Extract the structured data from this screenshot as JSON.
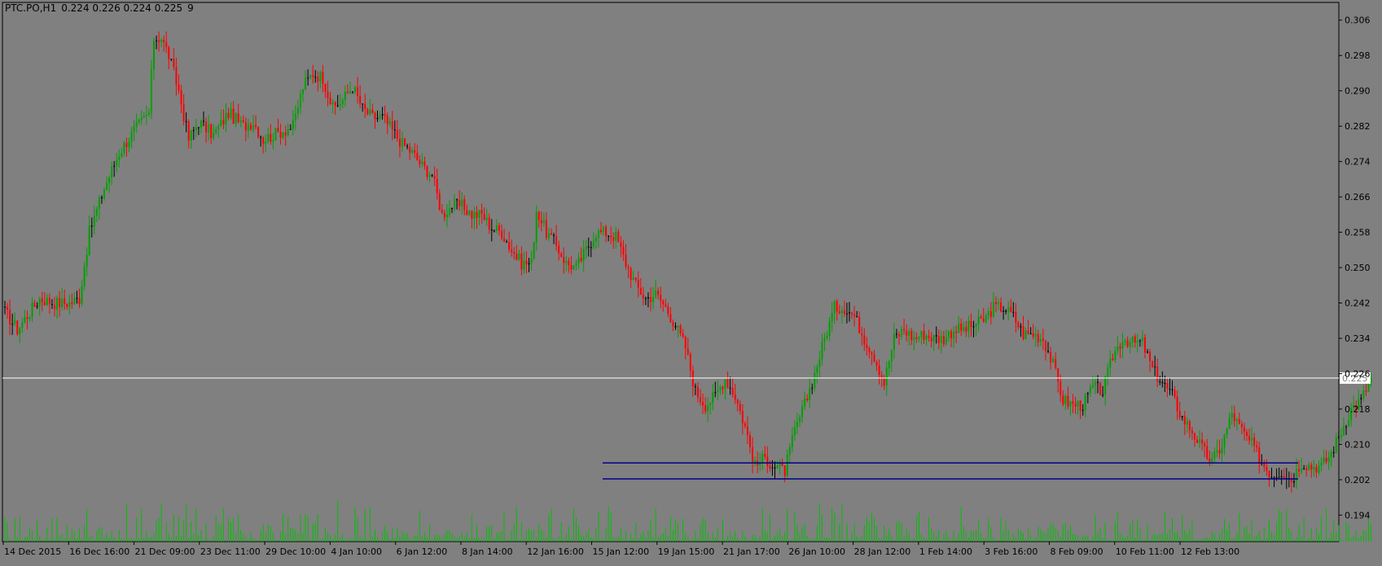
{
  "header": {
    "symbol": "PTC.PO,H1",
    "ohlc": "0.224 0.226 0.224 0.225",
    "spread": "9"
  },
  "current_price_label": "0.225",
  "colors": {
    "background": "#808080",
    "bull": "#00a000",
    "bear": "#ff0000",
    "doji": "#000000",
    "volume": "#00c000",
    "support_lines": "#00008b",
    "bid_line": "#ffffff",
    "axis": "#000000"
  },
  "chart_data": {
    "type": "candlestick",
    "title": "",
    "ylim": [
      0.188,
      0.31
    ],
    "y_ticks": [
      "0.306",
      "0.298",
      "0.290",
      "0.282",
      "0.274",
      "0.266",
      "0.258",
      "0.250",
      "0.242",
      "0.234",
      "0.226",
      "0.218",
      "0.210",
      "0.202",
      "0.194"
    ],
    "x_ticks": [
      "14 Dec 2015",
      "16 Dec 16:00",
      "21 Dec 09:00",
      "23 Dec 11:00",
      "29 Dec 10:00",
      "4 Jan 10:00",
      "6 Jan 12:00",
      "8 Jan 14:00",
      "12 Jan 16:00",
      "15 Jan 12:00",
      "19 Jan 15:00",
      "21 Jan 17:00",
      "26 Jan 10:00",
      "28 Jan 12:00",
      "1 Feb 14:00",
      "3 Feb 16:00",
      "8 Feb 09:00",
      "10 Feb 11:00",
      "12 Feb 13:00"
    ],
    "price_path": [
      [
        0,
        0.24
      ],
      [
        5,
        0.236
      ],
      [
        10,
        0.24
      ],
      [
        14,
        0.243
      ],
      [
        20,
        0.242
      ],
      [
        26,
        0.242
      ],
      [
        30,
        0.243
      ],
      [
        34,
        0.258
      ],
      [
        40,
        0.268
      ],
      [
        46,
        0.276
      ],
      [
        52,
        0.281
      ],
      [
        58,
        0.285
      ],
      [
        60,
        0.302
      ],
      [
        63,
        0.302
      ],
      [
        66,
        0.298
      ],
      [
        70,
        0.29
      ],
      [
        74,
        0.279
      ],
      [
        78,
        0.283
      ],
      [
        84,
        0.28
      ],
      [
        90,
        0.285
      ],
      [
        96,
        0.282
      ],
      [
        100,
        0.283
      ],
      [
        104,
        0.279
      ],
      [
        108,
        0.28
      ],
      [
        112,
        0.281
      ],
      [
        116,
        0.282
      ],
      [
        120,
        0.291
      ],
      [
        124,
        0.294
      ],
      [
        128,
        0.293
      ],
      [
        132,
        0.286
      ],
      [
        136,
        0.288
      ],
      [
        140,
        0.291
      ],
      [
        144,
        0.286
      ],
      [
        148,
        0.284
      ],
      [
        152,
        0.284
      ],
      [
        156,
        0.281
      ],
      [
        160,
        0.278
      ],
      [
        164,
        0.276
      ],
      [
        168,
        0.273
      ],
      [
        172,
        0.271
      ],
      [
        176,
        0.262
      ],
      [
        180,
        0.264
      ],
      [
        184,
        0.264
      ],
      [
        188,
        0.262
      ],
      [
        192,
        0.262
      ],
      [
        196,
        0.259
      ],
      [
        200,
        0.258
      ],
      [
        204,
        0.254
      ],
      [
        208,
        0.251
      ],
      [
        212,
        0.251
      ],
      [
        214,
        0.263
      ],
      [
        218,
        0.258
      ],
      [
        222,
        0.255
      ],
      [
        226,
        0.251
      ],
      [
        230,
        0.25
      ],
      [
        234,
        0.254
      ],
      [
        238,
        0.258
      ],
      [
        242,
        0.258
      ],
      [
        246,
        0.257
      ],
      [
        250,
        0.251
      ],
      [
        254,
        0.246
      ],
      [
        258,
        0.243
      ],
      [
        262,
        0.244
      ],
      [
        266,
        0.241
      ],
      [
        270,
        0.237
      ],
      [
        274,
        0.232
      ],
      [
        278,
        0.222
      ],
      [
        282,
        0.219
      ],
      [
        286,
        0.221
      ],
      [
        290,
        0.225
      ],
      [
        294,
        0.221
      ],
      [
        298,
        0.214
      ],
      [
        302,
        0.205
      ],
      [
        306,
        0.207
      ],
      [
        310,
        0.205
      ],
      [
        314,
        0.204
      ],
      [
        318,
        0.213
      ],
      [
        322,
        0.219
      ],
      [
        326,
        0.226
      ],
      [
        330,
        0.234
      ],
      [
        334,
        0.241
      ],
      [
        338,
        0.241
      ],
      [
        342,
        0.239
      ],
      [
        346,
        0.234
      ],
      [
        350,
        0.23
      ],
      [
        354,
        0.224
      ],
      [
        358,
        0.234
      ],
      [
        362,
        0.236
      ],
      [
        366,
        0.234
      ],
      [
        370,
        0.235
      ],
      [
        374,
        0.234
      ],
      [
        378,
        0.234
      ],
      [
        382,
        0.236
      ],
      [
        386,
        0.236
      ],
      [
        390,
        0.237
      ],
      [
        394,
        0.238
      ],
      [
        398,
        0.241
      ],
      [
        402,
        0.241
      ],
      [
        406,
        0.239
      ],
      [
        410,
        0.235
      ],
      [
        414,
        0.235
      ],
      [
        418,
        0.234
      ],
      [
        422,
        0.228
      ],
      [
        426,
        0.22
      ],
      [
        430,
        0.219
      ],
      [
        434,
        0.219
      ],
      [
        438,
        0.223
      ],
      [
        442,
        0.222
      ],
      [
        446,
        0.23
      ],
      [
        450,
        0.234
      ],
      [
        454,
        0.233
      ],
      [
        458,
        0.233
      ],
      [
        462,
        0.227
      ],
      [
        466,
        0.224
      ],
      [
        470,
        0.221
      ],
      [
        474,
        0.216
      ],
      [
        478,
        0.213
      ],
      [
        482,
        0.209
      ],
      [
        486,
        0.206
      ],
      [
        490,
        0.21
      ],
      [
        494,
        0.217
      ],
      [
        498,
        0.213
      ],
      [
        502,
        0.21
      ],
      [
        506,
        0.206
      ],
      [
        510,
        0.203
      ],
      [
        514,
        0.204
      ],
      [
        518,
        0.202
      ],
      [
        522,
        0.206
      ],
      [
        526,
        0.205
      ],
      [
        530,
        0.205
      ],
      [
        534,
        0.208
      ],
      [
        538,
        0.213
      ],
      [
        542,
        0.218
      ],
      [
        546,
        0.22
      ],
      [
        550,
        0.225
      ]
    ],
    "support_lines": [
      0.2058,
      0.2022
    ],
    "current_price": 0.225
  }
}
